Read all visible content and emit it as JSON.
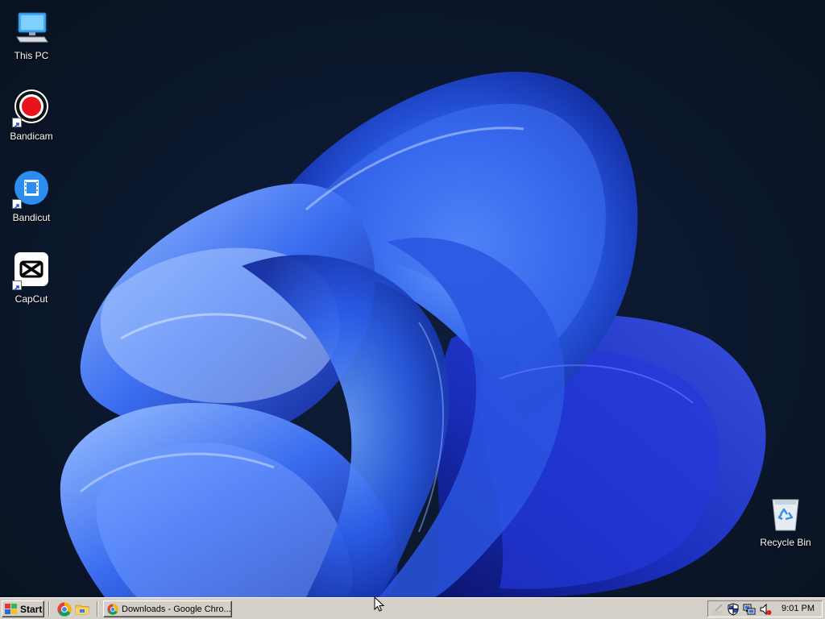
{
  "desktop": {
    "icons": [
      {
        "label": "This PC",
        "icon": "this-pc-icon"
      },
      {
        "label": "Bandicam",
        "icon": "bandicam-icon"
      },
      {
        "label": "Bandicut",
        "icon": "bandicut-icon"
      },
      {
        "label": "CapCut",
        "icon": "capcut-icon"
      },
      {
        "label": "Recycle Bin",
        "icon": "recycle-bin-icon"
      }
    ]
  },
  "taskbar": {
    "start_label": "Start",
    "quick_launch": [
      "chrome-icon",
      "file-explorer-icon"
    ],
    "tasks": [
      {
        "label": "Downloads - Google Chro...",
        "icon": "chrome-icon"
      }
    ],
    "tray": {
      "icons": [
        "network-status-icon",
        "security-shield-icon",
        "network-icon",
        "volume-muted-icon"
      ],
      "clock": "9:01 PM"
    }
  },
  "colors": {
    "taskbar_face": "#d4d0c8",
    "wallpaper_bg": "#0b172c",
    "bloom_blue": "#1f4fd6"
  }
}
